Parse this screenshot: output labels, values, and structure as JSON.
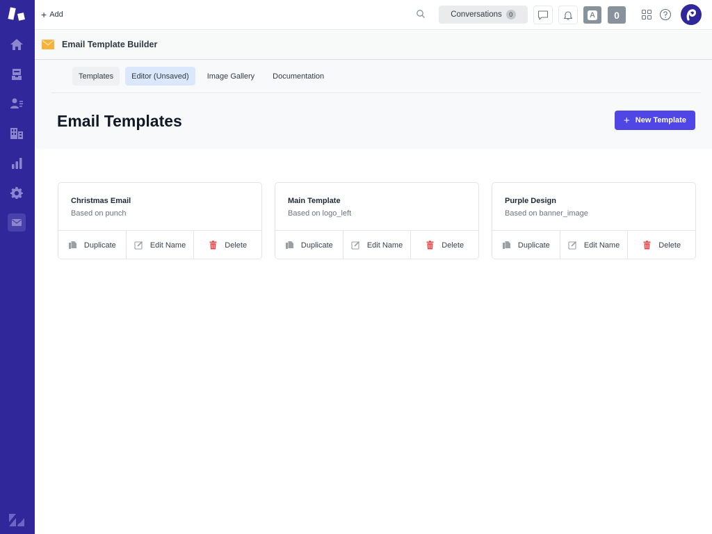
{
  "topbar": {
    "add_label": "Add",
    "conversations_label": "Conversations",
    "conversations_count": "0",
    "badge_a": "A",
    "badge_zero": "0"
  },
  "sidebar": {
    "items": [
      {
        "name": "home",
        "icon": "home-icon"
      },
      {
        "name": "views",
        "icon": "inbox-icon"
      },
      {
        "name": "customers",
        "icon": "contacts-icon"
      },
      {
        "name": "organizations",
        "icon": "building-icon"
      },
      {
        "name": "reporting",
        "icon": "bar-chart-icon"
      },
      {
        "name": "admin",
        "icon": "gear-icon"
      },
      {
        "name": "email-template-builder",
        "icon": "mail-icon",
        "active": true
      }
    ]
  },
  "app": {
    "title": "Email Template Builder",
    "accent_color": "#4f46e5",
    "sidebar_color": "#30279a",
    "icon_color": "#f7b23b"
  },
  "tabs": [
    {
      "label": "Templates",
      "state": "gray"
    },
    {
      "label": "Editor (Unsaved)",
      "state": "active"
    },
    {
      "label": "Image Gallery",
      "state": "normal"
    },
    {
      "label": "Documentation",
      "state": "normal"
    }
  ],
  "page": {
    "title": "Email Templates",
    "new_button_label": "New Template"
  },
  "templates": [
    {
      "name": "Christmas Email",
      "subtitle": "Based on punch"
    },
    {
      "name": "Main Template",
      "subtitle": "Based on logo_left"
    },
    {
      "name": "Purple Design",
      "subtitle": "Based on banner_image"
    }
  ],
  "actions": {
    "duplicate": "Duplicate",
    "edit_name": "Edit Name",
    "delete": "Delete"
  }
}
